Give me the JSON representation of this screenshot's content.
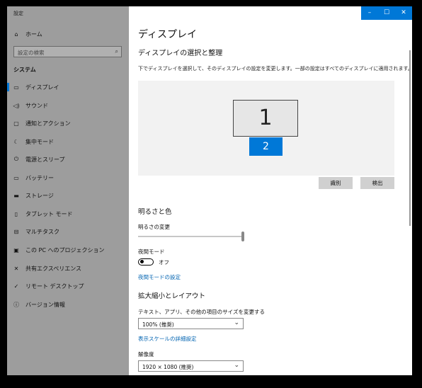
{
  "window": {
    "title": "設定"
  },
  "titlebar": {
    "minimize": "–",
    "maximize": "☐",
    "close": "✕"
  },
  "sidebar": {
    "home": "ホーム",
    "search_placeholder": "設定の検索",
    "section": "システム",
    "items": [
      {
        "label": "ディスプレイ",
        "icon": "monitor-icon",
        "active": true
      },
      {
        "label": "サウンド",
        "icon": "speaker-icon"
      },
      {
        "label": "通知とアクション",
        "icon": "notification-icon"
      },
      {
        "label": "集中モード",
        "icon": "moon-icon"
      },
      {
        "label": "電源とスリープ",
        "icon": "power-icon"
      },
      {
        "label": "バッテリー",
        "icon": "battery-icon"
      },
      {
        "label": "ストレージ",
        "icon": "storage-icon"
      },
      {
        "label": "タブレット モード",
        "icon": "tablet-icon"
      },
      {
        "label": "マルチタスク",
        "icon": "multitask-icon"
      },
      {
        "label": "この PC へのプロジェクション",
        "icon": "projection-icon"
      },
      {
        "label": "共有エクスペリエンス",
        "icon": "share-icon"
      },
      {
        "label": "リモート デスクトップ",
        "icon": "remote-icon"
      },
      {
        "label": "バージョン情報",
        "icon": "info-icon"
      }
    ]
  },
  "main": {
    "title": "ディスプレイ",
    "arrange_heading": "ディスプレイの選択と整理",
    "arrange_desc": "下でディスプレイを選択して、そのディスプレイの設定を変更します。一部の設定はすべてのディスプレイに適用されます。",
    "monitors": [
      "1",
      "2"
    ],
    "identify_button": "識別",
    "detect_button": "検出",
    "brightness_heading": "明るさと色",
    "brightness_label": "明るさの変更",
    "brightness_value": 1.0,
    "night_light_label": "夜間モード",
    "night_light_state": "オフ",
    "night_light_link": "夜間モードの設定",
    "scale_heading": "拡大縮小とレイアウト",
    "scale_label": "テキスト、アプリ、その他の項目のサイズを変更する",
    "scale_value": "100% (推奨)",
    "scale_link": "表示スケールの詳細設定",
    "resolution_label": "解像度",
    "resolution_value": "1920 × 1080 (推奨)"
  },
  "colors": {
    "accent": "#0078d7",
    "sidebar_bg": "#9d9d9d",
    "link": "#0063b1"
  }
}
